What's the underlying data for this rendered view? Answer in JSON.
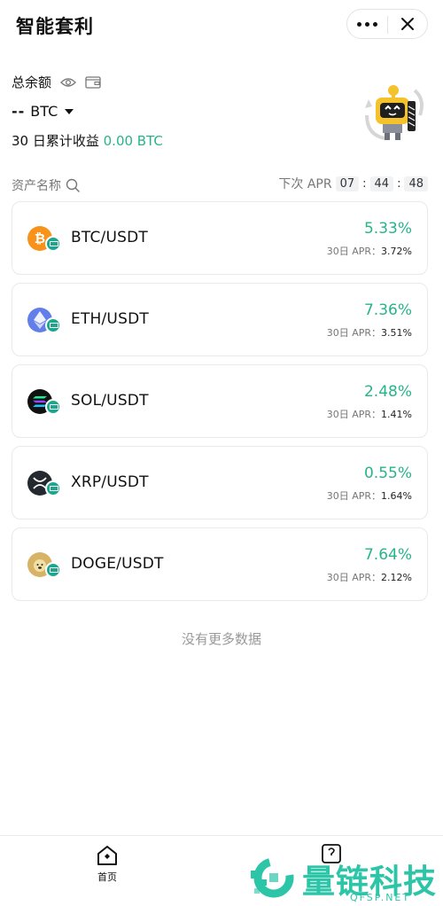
{
  "header": {
    "title": "智能套利"
  },
  "balance": {
    "label": "总余额",
    "value": "--",
    "currency": "BTC",
    "earnings_label": "30 日累计收益",
    "earnings_value": "0.00 BTC"
  },
  "list_header": {
    "asset_label": "资产名称",
    "next_apr_label": "下次 APR",
    "countdown": {
      "hh": "07",
      "mm": "44",
      "ss": "48"
    }
  },
  "assets": [
    {
      "pair": "BTC/USDT",
      "apr": "5.33%",
      "apr30_label": "30日 APR：",
      "apr30": "3.72%",
      "icon": "bitcoin-icon",
      "color": "#f7931a"
    },
    {
      "pair": "ETH/USDT",
      "apr": "7.36%",
      "apr30_label": "30日 APR：",
      "apr30": "3.51%",
      "icon": "ethereum-icon",
      "color": "#627eea"
    },
    {
      "pair": "SOL/USDT",
      "apr": "2.48%",
      "apr30_label": "30日 APR：",
      "apr30": "1.41%",
      "icon": "solana-icon",
      "color": "#111111"
    },
    {
      "pair": "XRP/USDT",
      "apr": "0.55%",
      "apr30_label": "30日 APR：",
      "apr30": "1.64%",
      "icon": "xrp-icon",
      "color": "#23292f"
    },
    {
      "pair": "DOGE/USDT",
      "apr": "7.64%",
      "apr30_label": "30日 APR：",
      "apr30": "2.12%",
      "icon": "doge-icon",
      "color": "#d7b465"
    }
  ],
  "footer": {
    "no_more": "没有更多数据"
  },
  "tabbar": {
    "home_label": "首页"
  },
  "watermark": {
    "brand": "量链科技",
    "domain": "QFSP.NET"
  },
  "colors": {
    "accent_green": "#26b48b",
    "tether_green": "#1ea58d"
  }
}
